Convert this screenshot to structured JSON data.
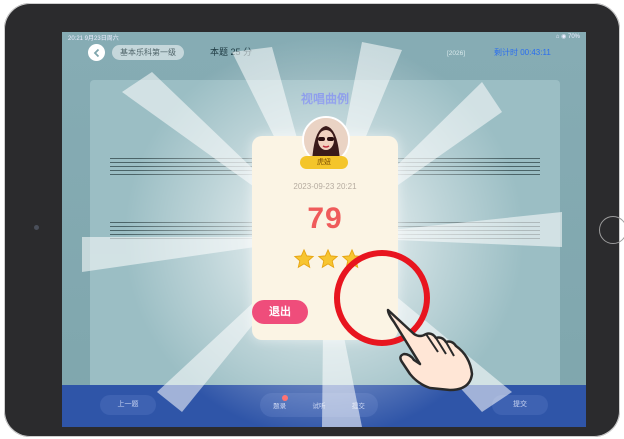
{
  "status": {
    "left": "20:21  9月23日周六",
    "right": "⌂ ◉ 70%"
  },
  "header": {
    "course_pill": "基本乐科第一级",
    "question_score": "本题 25 分",
    "tag": "[2026]",
    "timer": "剩计时 00:43:11"
  },
  "sheet": {
    "title": "视唱曲例"
  },
  "bottom": {
    "prev": "上一题",
    "tabs": [
      "题录",
      "试听",
      "提交"
    ],
    "submit": "提交"
  },
  "dialog": {
    "name": "虎妞",
    "date": "2023-09-23 20:21",
    "score": "79",
    "stars": 3,
    "exit_label": "退出"
  },
  "colors": {
    "accent": "#2f55a8",
    "score": "#ef5b5b",
    "exit": "#ef4d7b",
    "highlight_ring": "#e8151f"
  }
}
